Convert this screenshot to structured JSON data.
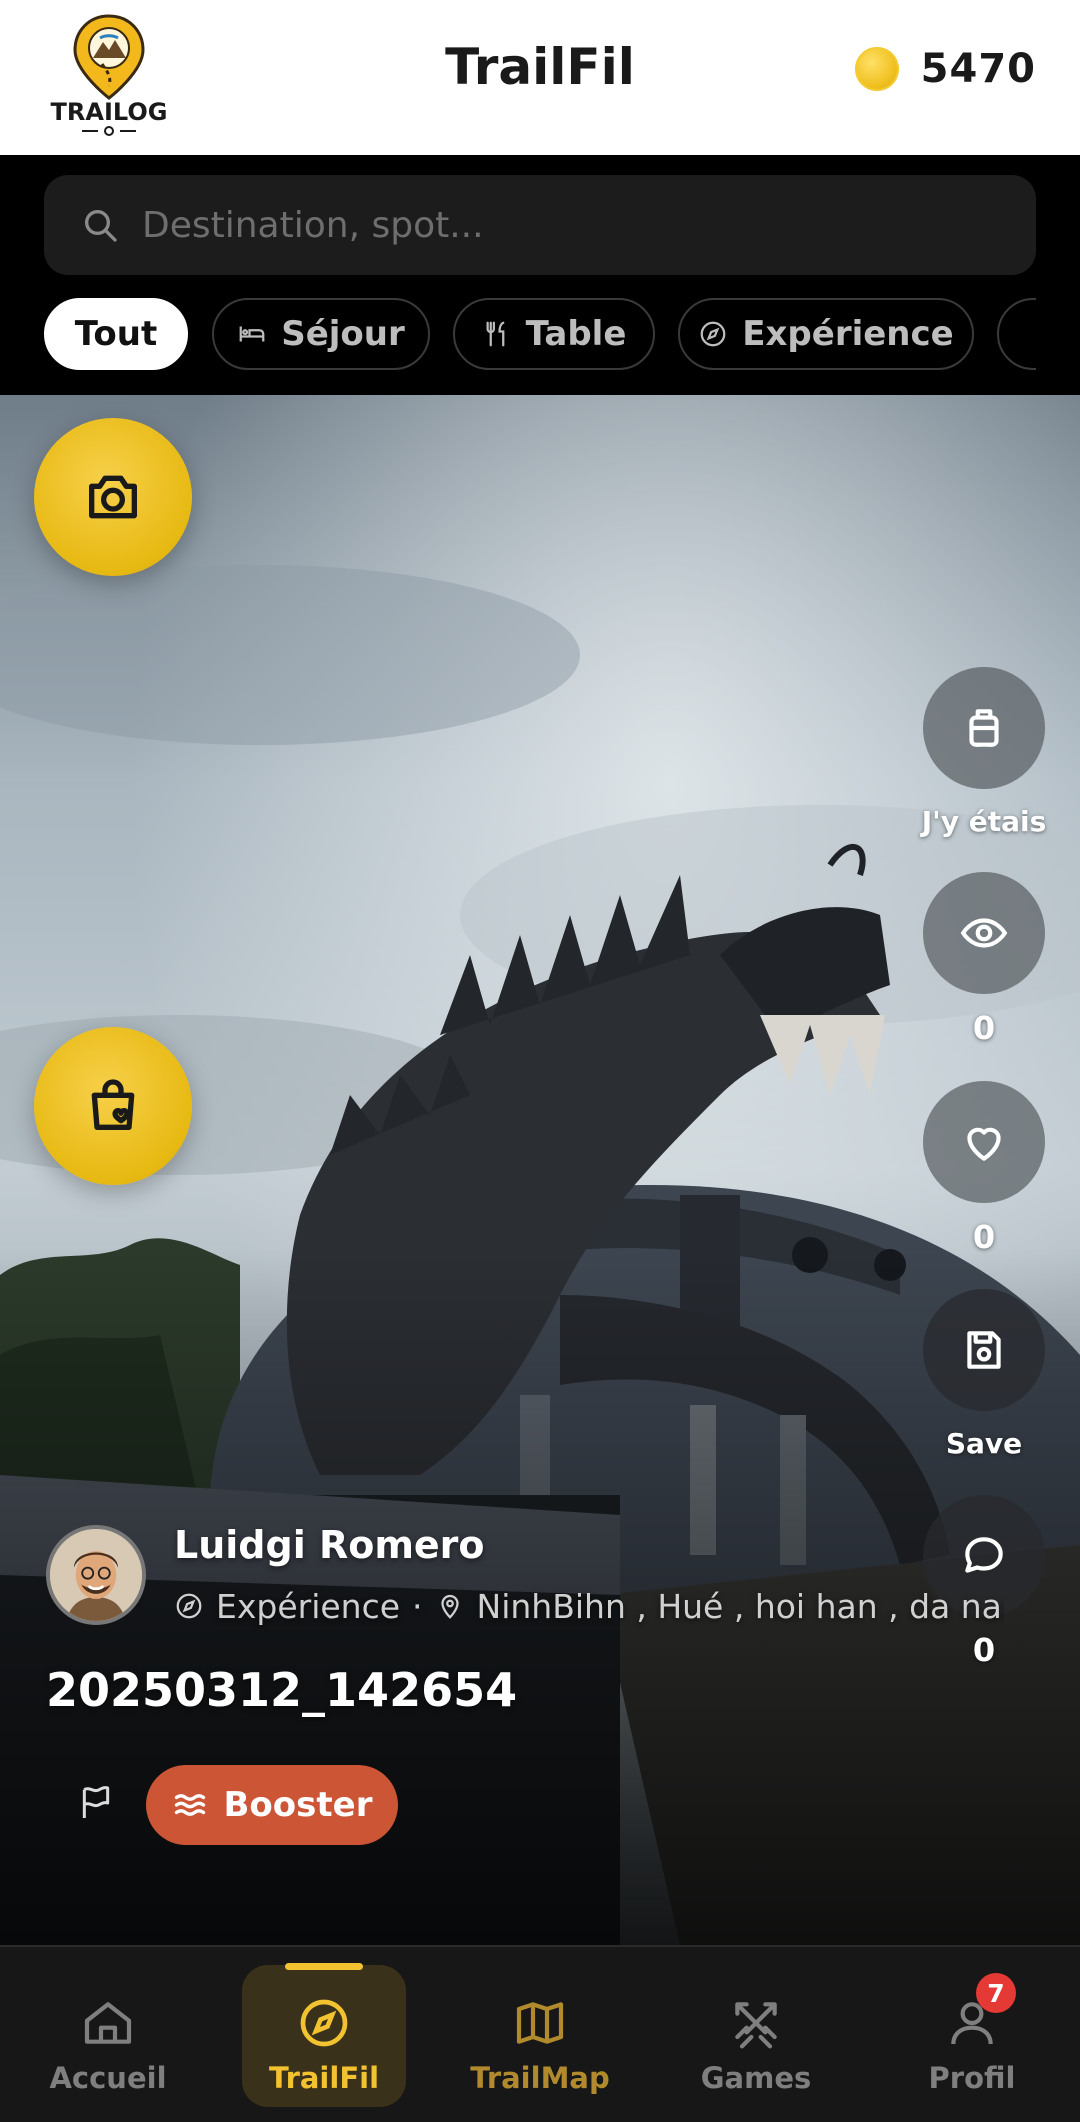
{
  "header": {
    "logo_text": "TRAILOG",
    "title": "TrailFil",
    "coins": "5470"
  },
  "search": {
    "placeholder": "Destination, spot..."
  },
  "filters": [
    {
      "label": "Tout",
      "icon": "all",
      "active": true
    },
    {
      "label": "Séjour",
      "icon": "bed-icon",
      "active": false
    },
    {
      "label": "Table",
      "icon": "cutlery-icon",
      "active": false
    },
    {
      "label": "Expérience",
      "icon": "compass-icon",
      "active": false
    }
  ],
  "post": {
    "author": "Luidgi Romero",
    "category": "Expérience",
    "separator": "·",
    "locations": "NinhBihn , Hué , hoi han , da nang",
    "title": "20250312_142654",
    "booster_label": "Booster"
  },
  "actions": {
    "was_here_label": "J'y étais",
    "views": "0",
    "likes": "0",
    "save_label": "Save",
    "comments": "0"
  },
  "nav": {
    "items": [
      {
        "label": "Accueil",
        "icon": "home-icon"
      },
      {
        "label": "TrailFil",
        "icon": "compass-icon",
        "active": true
      },
      {
        "label": "TrailMap",
        "icon": "map-icon"
      },
      {
        "label": "Games",
        "icon": "swords-icon"
      },
      {
        "label": "Profil",
        "icon": "user-icon"
      }
    ],
    "profile_badge": "7"
  },
  "colors": {
    "accent": "#f2c230",
    "booster": "#cc5536",
    "badge": "#e53935"
  }
}
